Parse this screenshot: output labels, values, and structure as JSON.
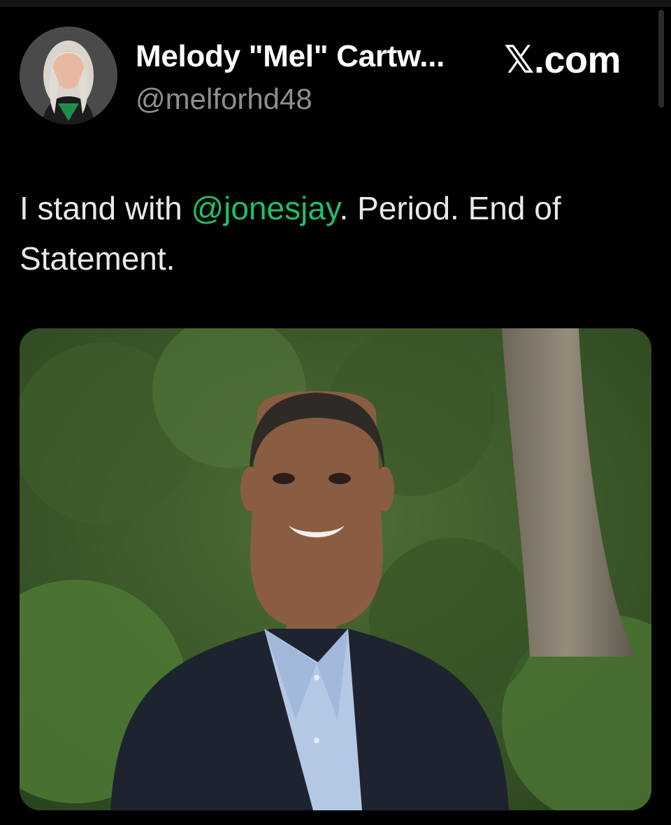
{
  "tweet": {
    "author": {
      "display_name": "Melody \"Mel\" Cartw...",
      "handle": "@melforhd48"
    },
    "source": {
      "x_glyph": "𝕏",
      "domain_suffix": ".com"
    },
    "text_before": "I stand with ",
    "mention": "@jonesjay",
    "text_after": ". Period. End of Statement.",
    "mention_color": "#1fbf6a"
  }
}
